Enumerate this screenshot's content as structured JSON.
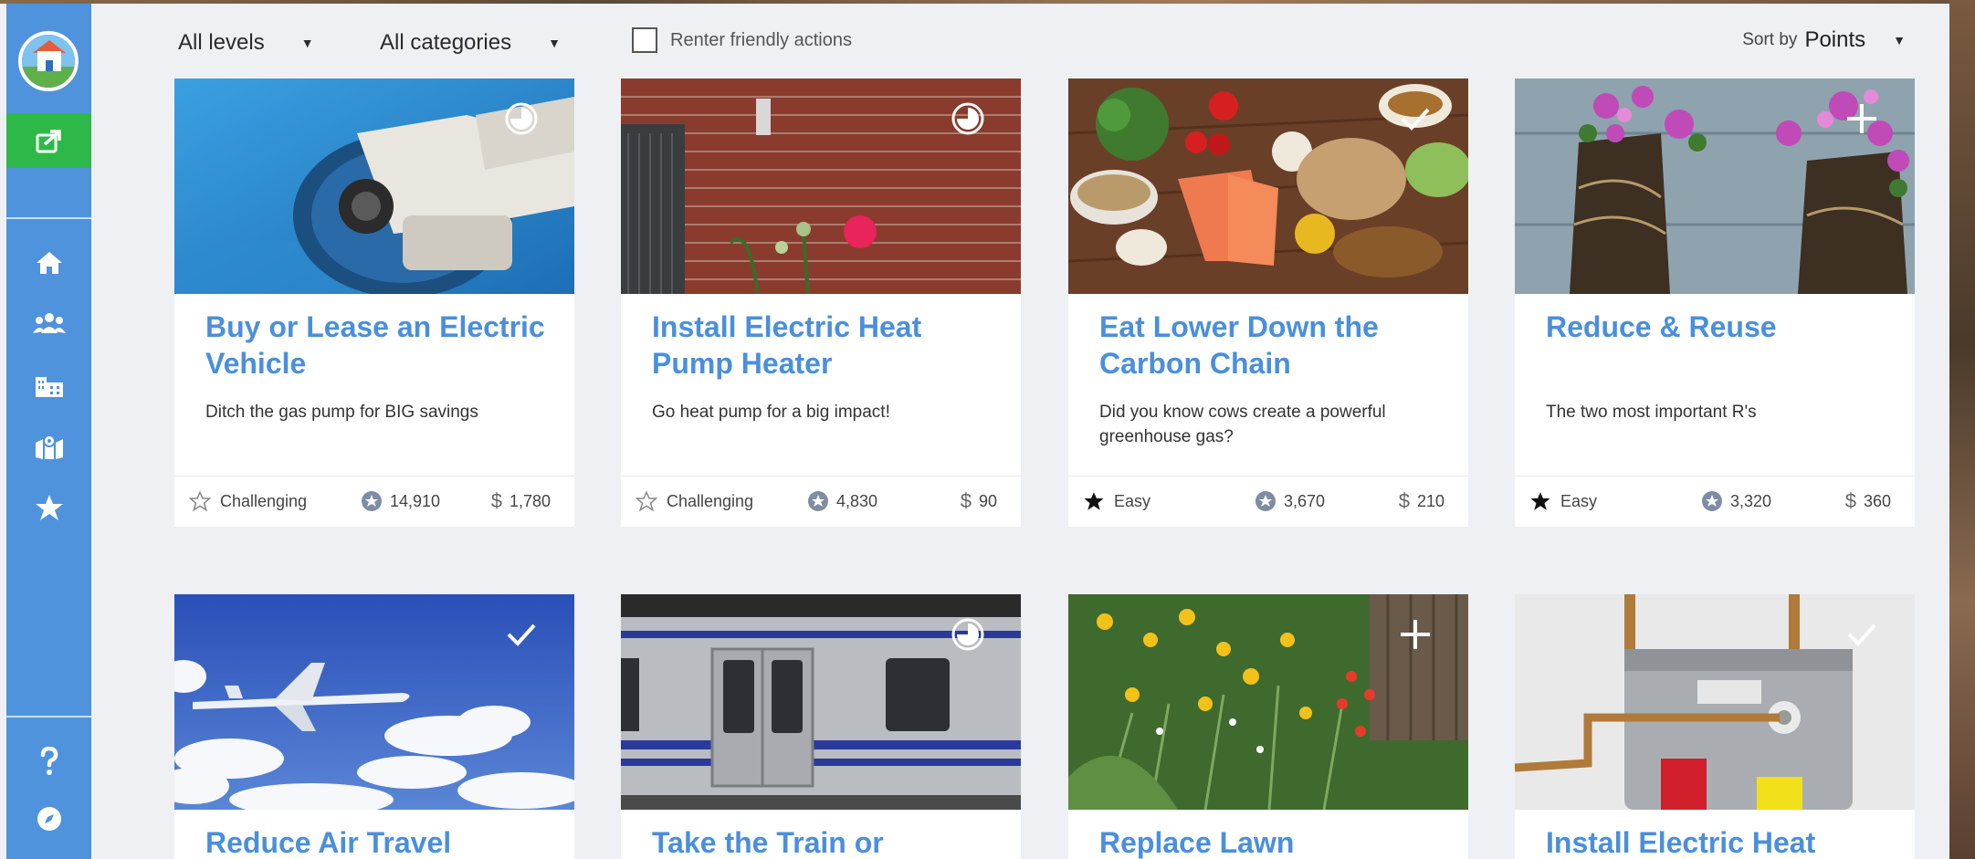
{
  "filters": {
    "levels": "All levels",
    "categories": "All categories",
    "renter_label": "Renter friendly actions",
    "sort_label": "Sort by",
    "sort_value": "Points"
  },
  "sidebar": {
    "items": [
      {
        "icon": "home-icon"
      },
      {
        "icon": "team-icon"
      },
      {
        "icon": "buildings-icon"
      },
      {
        "icon": "map-icon"
      },
      {
        "icon": "star-icon"
      },
      {
        "icon": "help-icon"
      },
      {
        "icon": "compass-icon"
      }
    ]
  },
  "cards": [
    {
      "title": "Buy or Lease an Electric Vehicle",
      "desc": "Ditch the gas pump for BIG savings",
      "level": "Challenging",
      "points": "14,910",
      "cost": "1,780",
      "status": "in-progress"
    },
    {
      "title": "Install Electric Heat Pump Heater",
      "desc": "Go heat pump for a big impact!",
      "level": "Challenging",
      "points": "4,830",
      "cost": "90",
      "status": "in-progress"
    },
    {
      "title": "Eat Lower Down the Carbon Chain",
      "desc": "Did you know cows create a powerful greenhouse gas?",
      "level": "Easy",
      "points": "3,670",
      "cost": "210",
      "status": "done"
    },
    {
      "title": "Reduce & Reuse",
      "desc": "The two most important R's",
      "level": "Easy",
      "points": "3,320",
      "cost": "360",
      "status": "add"
    },
    {
      "title": "Reduce Air Travel",
      "status": "done"
    },
    {
      "title": "Take the Train or",
      "status": "in-progress"
    },
    {
      "title": "Replace Lawn",
      "status": "add"
    },
    {
      "title": "Install Electric Heat",
      "status": "done"
    }
  ]
}
